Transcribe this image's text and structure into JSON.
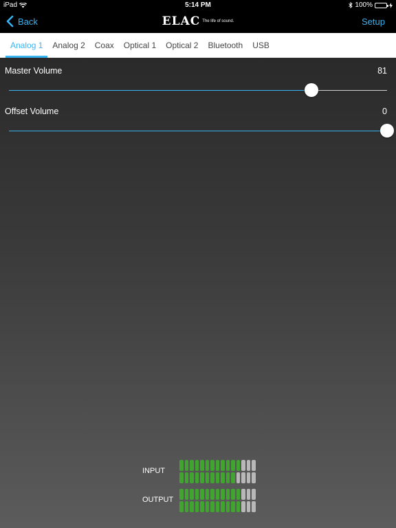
{
  "status": {
    "device": "iPad",
    "time": "5:14 PM",
    "battery": "100%",
    "battery_level": 1.0
  },
  "nav": {
    "back_label": "Back",
    "logo_text": "ELAC",
    "logo_tagline": "The life of sound.",
    "setup_label": "Setup"
  },
  "tabs": [
    {
      "label": "Analog 1",
      "active": true
    },
    {
      "label": "Analog 2",
      "active": false
    },
    {
      "label": "Coax",
      "active": false
    },
    {
      "label": "Optical 1",
      "active": false
    },
    {
      "label": "Optical 2",
      "active": false
    },
    {
      "label": "Bluetooth",
      "active": false
    },
    {
      "label": "USB",
      "active": false
    }
  ],
  "master_volume": {
    "label": "Master Volume",
    "value": "81",
    "fill_fraction": 0.8
  },
  "offset_volume": {
    "label": "Offset Volume",
    "value": "0",
    "fill_fraction": 1.0
  },
  "meters": {
    "total_segments": 15,
    "input": {
      "label": "INPUT",
      "channels_lit": [
        12,
        11
      ]
    },
    "output": {
      "label": "OUTPUT",
      "channels_lit": [
        12,
        12
      ]
    }
  },
  "colors": {
    "accent": "#3ab4f2",
    "meter_on": "#3fa52f",
    "meter_off": "#b8b8b8"
  }
}
